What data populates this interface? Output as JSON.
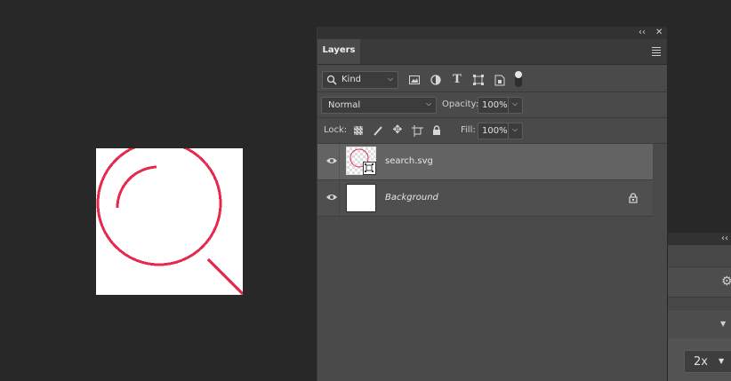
{
  "panel": {
    "collapse_glyph": "‹‹",
    "close_glyph": "✕",
    "tab_label": "Layers",
    "menu_icon": "hamburger-menu-icon"
  },
  "filter": {
    "kind_label": "Kind",
    "icons": [
      "image-filter-icon",
      "adjustment-filter-icon",
      "type-filter-icon",
      "shape-filter-icon",
      "smart-object-filter-icon",
      "filter-toggle-icon"
    ]
  },
  "blend": {
    "mode": "Normal",
    "opacity_label": "Opacity:",
    "opacity_value": "100%"
  },
  "lock": {
    "label": "Lock:",
    "icons": [
      "lock-transparent-pixels-icon",
      "lock-image-pixels-icon",
      "lock-position-icon",
      "lock-artboard-icon",
      "lock-all-icon"
    ],
    "fill_label": "Fill:",
    "fill_value": "100%"
  },
  "layers": [
    {
      "name": "search.svg",
      "italic": false,
      "selected": true,
      "visible": true,
      "smart_object": true,
      "locked": false
    },
    {
      "name": "Background",
      "italic": true,
      "selected": false,
      "visible": true,
      "smart_object": false,
      "locked": true
    }
  ],
  "secondary_panel": {
    "collapse_glyph": "‹‹",
    "scale_value": "2x"
  },
  "colors": {
    "accent_icon": "#e8294e",
    "panel_bg": "#4a4a4a",
    "selected_row": "#636363",
    "app_bg": "#282828"
  }
}
